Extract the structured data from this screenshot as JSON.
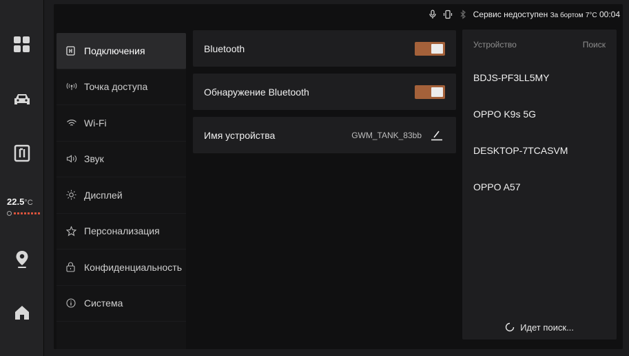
{
  "status_bar": {
    "icons": [
      "microphone-icon",
      "vibrate-icon",
      "bluetooth-icon"
    ],
    "service_text": "Сервис недоступен",
    "outside_label": "За бортом",
    "outside_temp": "7°C",
    "time": "00:04"
  },
  "dock": {
    "items": [
      "apps-grid-icon",
      "car-icon",
      "parking-icon",
      "climate",
      "navigation-pin-icon",
      "home-icon"
    ],
    "temperature": {
      "value": "22.5",
      "unit": "°C"
    }
  },
  "menu": {
    "items": [
      {
        "label": "Подключения",
        "icon": "connections-icon",
        "active": true
      },
      {
        "label": "Точка доступа",
        "icon": "hotspot-icon",
        "active": false
      },
      {
        "label": "Wi-Fi",
        "icon": "wifi-icon",
        "active": false
      },
      {
        "label": "Звук",
        "icon": "sound-icon",
        "active": false
      },
      {
        "label": "Дисплей",
        "icon": "brightness-icon",
        "active": false
      },
      {
        "label": "Персонализация",
        "icon": "personalization-icon",
        "active": false
      },
      {
        "label": "Конфиденциальность",
        "icon": "privacy-lock-icon",
        "active": false
      },
      {
        "label": "Система",
        "icon": "info-icon",
        "active": false
      }
    ]
  },
  "settings": {
    "bluetooth": {
      "label": "Bluetooth",
      "enabled": true
    },
    "discovery": {
      "label": "Обнаружение Bluetooth",
      "enabled": true
    },
    "device_name": {
      "label": "Имя устройства",
      "value": "GWM_TANK_83bb"
    }
  },
  "devices_panel": {
    "title": "Устройство",
    "search_label": "Поиск",
    "devices": [
      "BDJS-PF3LL5MY",
      "OPPO K9s 5G",
      "DESKTOP-7TCASVM",
      "OPPO A57"
    ],
    "searching_text": "Идет поиск..."
  },
  "colors": {
    "accent_toggle": "#a4613a",
    "background": "#101011",
    "panel": "#1e1e20"
  }
}
